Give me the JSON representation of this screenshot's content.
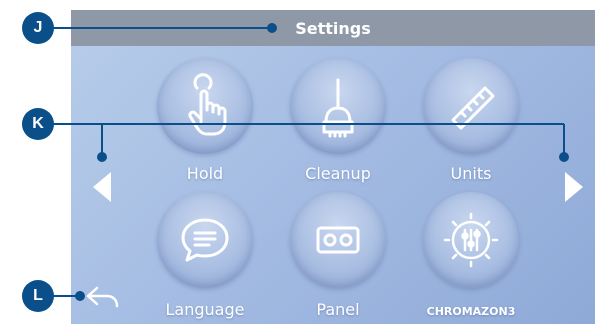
{
  "title": "Settings",
  "tiles": [
    {
      "label": "Hold",
      "icon": "hold-hand-icon"
    },
    {
      "label": "Cleanup",
      "icon": "broom-icon"
    },
    {
      "label": "Units",
      "icon": "ruler-icon"
    },
    {
      "label": "Language",
      "icon": "speech-bubble-icon"
    },
    {
      "label": "Panel",
      "icon": "panel-icon"
    },
    {
      "label": "CHROMAZON3",
      "icon": "chromazon3-icon"
    }
  ],
  "callouts": [
    "J",
    "K",
    "L"
  ],
  "colors": {
    "callout": "#0b4f8a",
    "title_bar": "#8e98a7",
    "screen_bg": "#a5bde3"
  }
}
